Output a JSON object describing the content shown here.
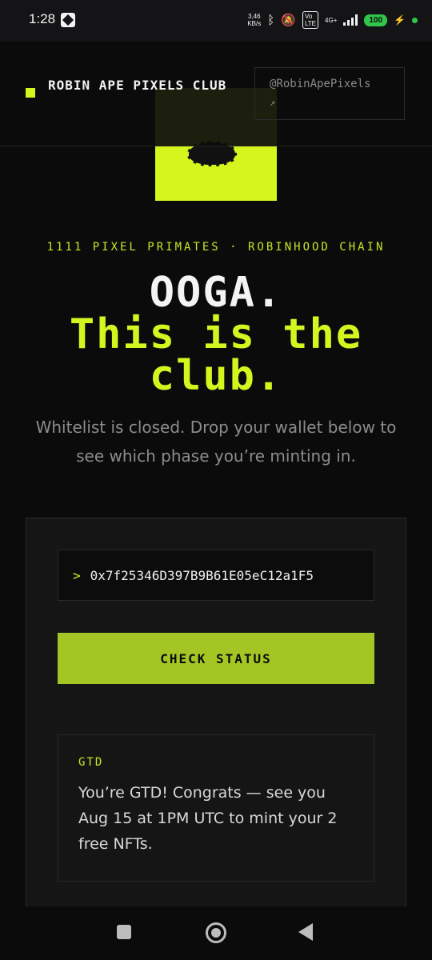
{
  "status_bar": {
    "time": "1:28",
    "net_speed": "3,46\nKB/s",
    "volte": "Vo\nLTE",
    "network": "4G+",
    "battery": "100"
  },
  "header": {
    "brand": "ROBIN APE PIXELS CLUB",
    "handle": "@RobinApePixels",
    "handle_arrow": "↗"
  },
  "hero": {
    "kicker": "1111 PIXEL PRIMATES · ROBINHOOD CHAIN",
    "title_line1": "OOGA.",
    "title_line2": "This is the",
    "title_line3": "club.",
    "lead": "Whitelist is closed. Drop your wallet below to see which phase you’re minting in."
  },
  "form": {
    "prompt": ">",
    "wallet_value": "0x7f25346D397B9B61E05eC12a1F5",
    "check_label": "CHECK STATUS"
  },
  "result": {
    "tag": "GTD",
    "message": "You’re GTD! Congrats — see you Aug 15 at 1PM UTC to mint your 2 free NFTs."
  },
  "colors": {
    "accent": "#d5f51f",
    "button": "#a3c624",
    "background": "#0b0b0c"
  }
}
